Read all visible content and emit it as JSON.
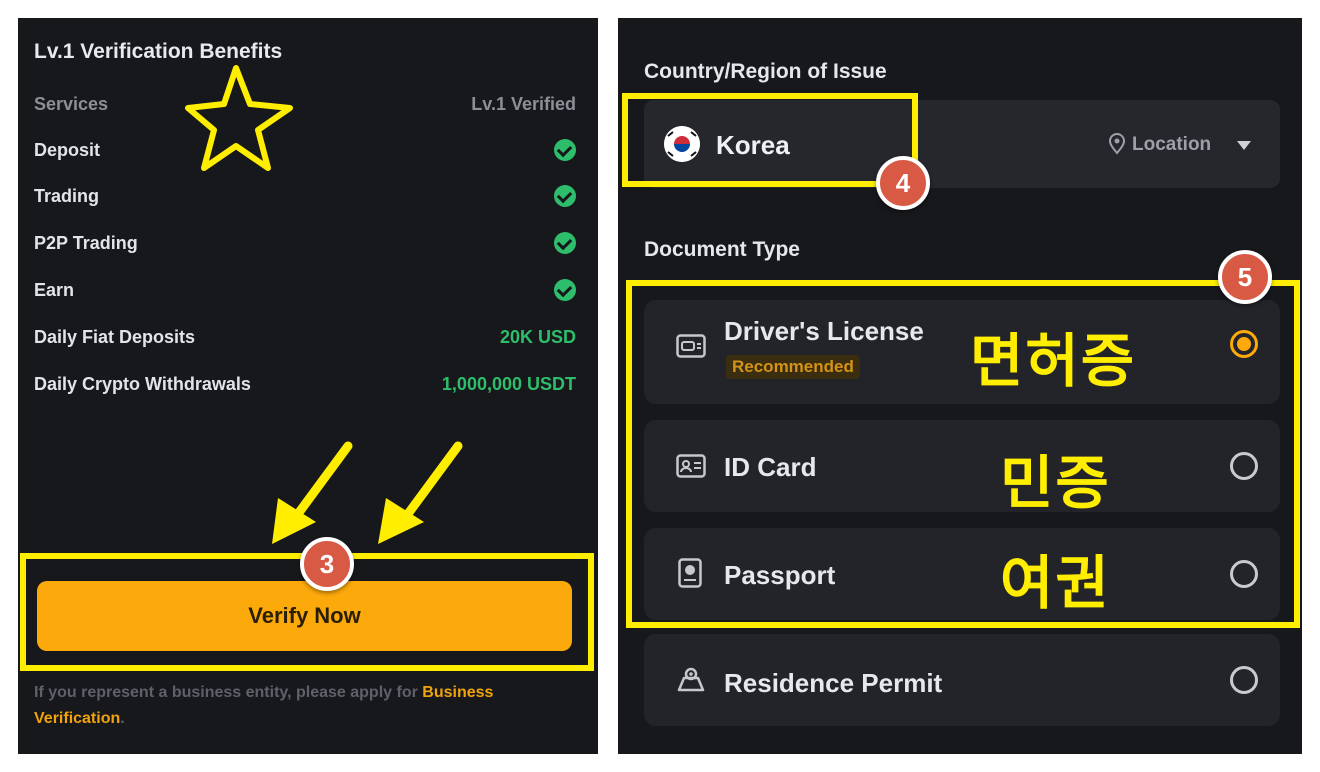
{
  "left": {
    "title": "Lv.1 Verification Benefits",
    "header_services": "Services",
    "header_level": "Lv.1 Verified",
    "rows": [
      {
        "label": "Deposit",
        "check": true
      },
      {
        "label": "Trading",
        "check": true
      },
      {
        "label": "P2P Trading",
        "check": true
      },
      {
        "label": "Earn",
        "check": true
      },
      {
        "label": "Daily Fiat Deposits",
        "value": "20K USD"
      },
      {
        "label": "Daily Crypto Withdrawals",
        "value": "1,000,000 USDT"
      }
    ],
    "verify_button": "Verify Now",
    "footer_text": "If you represent a business entity, please apply for ",
    "footer_link": "Business Verification",
    "footer_end": ".",
    "step_badge": "3"
  },
  "right": {
    "country_label": "Country/Region of Issue",
    "country_value": "Korea",
    "location_label": "Location",
    "step4_badge": "4",
    "doc_type_label": "Document Type",
    "step5_badge": "5",
    "documents": [
      {
        "name": "Driver's License",
        "tag": "Recommended",
        "selected": true,
        "korean": "면허증"
      },
      {
        "name": "ID Card",
        "selected": false,
        "korean": "민증"
      },
      {
        "name": "Passport",
        "selected": false,
        "korean": "여권"
      },
      {
        "name": "Residence Permit",
        "selected": false
      }
    ]
  },
  "colors": {
    "accent": "#fcaa0b",
    "success": "#2ebd6b",
    "highlight": "#ffee00",
    "badge": "#d85a45",
    "panel": "#17181c"
  }
}
